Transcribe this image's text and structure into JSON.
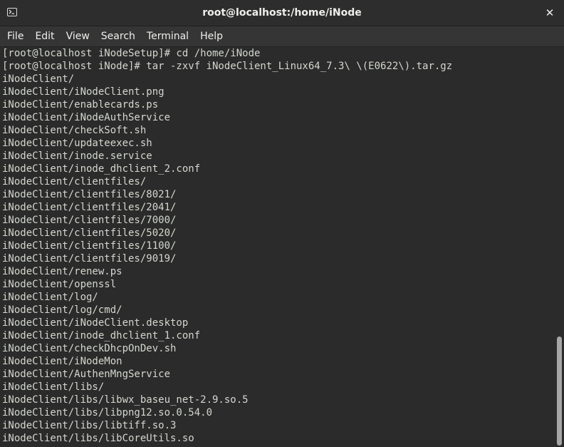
{
  "window": {
    "title": "root@localhost:/home/iNode",
    "close_label": "✕"
  },
  "menu": [
    "File",
    "Edit",
    "View",
    "Search",
    "Terminal",
    "Help"
  ],
  "terminal": {
    "lines": [
      "[root@localhost iNodeSetup]# cd /home/iNode",
      "[root@localhost iNode]# tar -zxvf iNodeClient_Linux64_7.3\\ \\(E0622\\).tar.gz",
      "iNodeClient/",
      "iNodeClient/iNodeClient.png",
      "iNodeClient/enablecards.ps",
      "iNodeClient/iNodeAuthService",
      "iNodeClient/checkSoft.sh",
      "iNodeClient/updateexec.sh",
      "iNodeClient/inode.service",
      "iNodeClient/inode_dhclient_2.conf",
      "iNodeClient/clientfiles/",
      "iNodeClient/clientfiles/8021/",
      "iNodeClient/clientfiles/2041/",
      "iNodeClient/clientfiles/7000/",
      "iNodeClient/clientfiles/5020/",
      "iNodeClient/clientfiles/1100/",
      "iNodeClient/clientfiles/9019/",
      "iNodeClient/renew.ps",
      "iNodeClient/openssl",
      "iNodeClient/log/",
      "iNodeClient/log/cmd/",
      "iNodeClient/iNodeClient.desktop",
      "iNodeClient/inode_dhclient_1.conf",
      "iNodeClient/checkDhcpOnDev.sh",
      "iNodeClient/iNodeMon",
      "iNodeClient/AuthenMngService",
      "iNodeClient/libs/",
      "iNodeClient/libs/libwx_baseu_net-2.9.so.5",
      "iNodeClient/libs/libpng12.so.0.54.0",
      "iNodeClient/libs/libtiff.so.3",
      "iNodeClient/libs/libCoreUtils.so"
    ]
  }
}
